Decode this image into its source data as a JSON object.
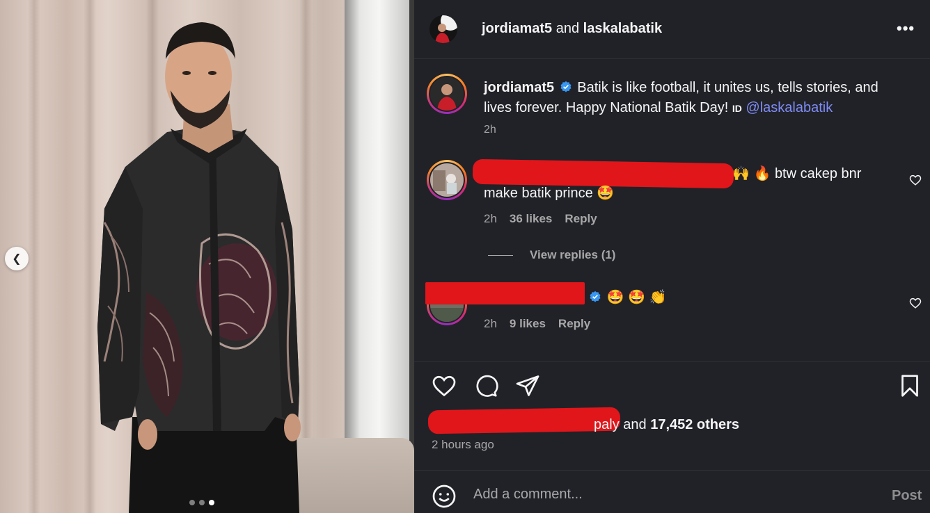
{
  "photo": {
    "carousel_dots": 3,
    "active_dot": 2
  },
  "header": {
    "author": "jordiamat5",
    "connector": "and",
    "collaborator": "laskalabatik",
    "more": "•••"
  },
  "caption": {
    "username": "jordiamat5",
    "text": "Batik is like football, it unites us, tells stories, and lives forever. Happy National Batik Day!",
    "id_tag": "ID",
    "mention": "@laskalabatik",
    "time": "2h"
  },
  "comments": [
    {
      "text_line1": "btw cakep bnr",
      "text_line2": "make batik prince",
      "time": "2h",
      "likes": "36 likes",
      "reply": "Reply",
      "view_replies": "View replies (1)"
    },
    {
      "time": "2h",
      "likes": "9 likes",
      "reply": "Reply"
    }
  ],
  "likes_line": {
    "suffix_fragment": "paly",
    "and_text": "and",
    "count": "17,452 others"
  },
  "posted_time": "2 hours ago",
  "composer": {
    "placeholder": "Add a comment...",
    "post": "Post"
  },
  "colors": {
    "panel_bg": "#212228",
    "mention": "#7f8cf5",
    "verified": "#3897f0",
    "redaction": "#e0161b"
  }
}
